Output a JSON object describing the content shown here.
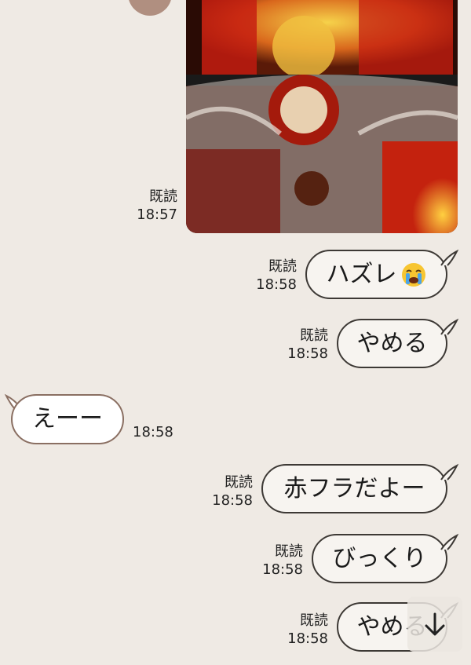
{
  "messages": [
    {
      "read": "既読",
      "time": "18:57"
    },
    {
      "read": "既読",
      "time": "18:58",
      "text": "ハズレ",
      "emoji": "crying-face"
    },
    {
      "read": "既読",
      "time": "18:58",
      "text": "やめる"
    },
    {
      "time": "18:58",
      "text": "えーー"
    },
    {
      "read": "既読",
      "time": "18:58",
      "text": "赤フラだよー"
    },
    {
      "read": "既読",
      "time": "18:58",
      "text": "びっくり"
    },
    {
      "read": "既読",
      "time": "18:58",
      "text": "やめる"
    }
  ],
  "icons": {
    "scroll": "arrow-down-icon",
    "avatar": "avatar"
  },
  "colors": {
    "background": "#efeae4",
    "bubble_border": "#3d3935",
    "incoming_border": "#8a6f62"
  }
}
